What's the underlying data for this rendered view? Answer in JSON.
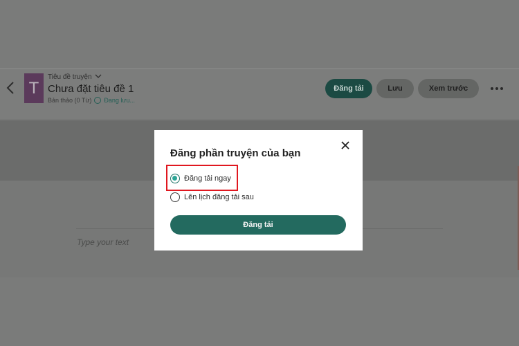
{
  "header": {
    "story_label": "Tiêu đề truyện",
    "cover_letter": "T",
    "part_title": "Chưa đặt tiêu đề 1",
    "meta_status": "Bản thảo (0 Từ)",
    "saving_text": "Đang lưu...",
    "buttons": {
      "publish": "Đăng tải",
      "save": "Lưu",
      "preview": "Xem trước"
    }
  },
  "editor": {
    "placeholder": "Type your text"
  },
  "modal": {
    "title": "Đăng phần truyện của bạn",
    "options": [
      {
        "label": "Đăng tải ngay",
        "selected": true
      },
      {
        "label": "Lên lịch đăng tải sau",
        "selected": false
      }
    ],
    "publish_label": "Đăng tải"
  },
  "colors": {
    "accent": "#236a5f",
    "highlight": "#e0171f",
    "radio_selected": "#2ca596"
  }
}
